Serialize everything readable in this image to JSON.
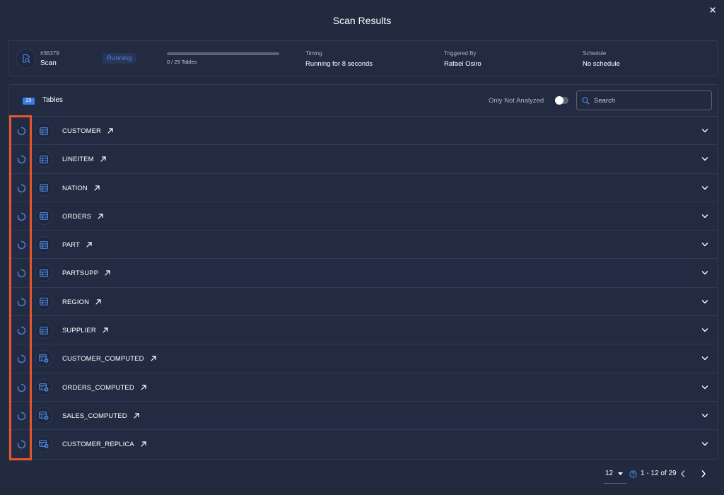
{
  "modal": {
    "title": "Scan Results",
    "close_icon": "close-icon"
  },
  "summary": {
    "scan_id": "#36379",
    "scan_name": "Scan",
    "status": "Running",
    "progress_text": "0 / 29 Tables",
    "progress_fraction": 0,
    "timing_label": "Timing",
    "timing_value": "Running for 8 seconds",
    "triggered_label": "Triggered By",
    "triggered_value": "Rafael Osiro",
    "schedule_label": "Schedule",
    "schedule_value": "No schedule"
  },
  "tables_panel": {
    "count": "29",
    "title": "Tables",
    "filter_label": "Only Not Analyzed",
    "filter_on": false,
    "search_placeholder": "Search",
    "rows": [
      {
        "name": "CUSTOMER",
        "icon": "table-icon"
      },
      {
        "name": "LINEITEM",
        "icon": "table-icon"
      },
      {
        "name": "NATION",
        "icon": "table-icon"
      },
      {
        "name": "ORDERS",
        "icon": "table-icon"
      },
      {
        "name": "PART",
        "icon": "table-icon"
      },
      {
        "name": "PARTSUPP",
        "icon": "table-icon"
      },
      {
        "name": "REGION",
        "icon": "table-icon"
      },
      {
        "name": "SUPPLIER",
        "icon": "table-icon"
      },
      {
        "name": "CUSTOMER_COMPUTED",
        "icon": "computed-table-icon"
      },
      {
        "name": "ORDERS_COMPUTED",
        "icon": "computed-table-icon"
      },
      {
        "name": "SALES_COMPUTED",
        "icon": "computed-table-icon"
      },
      {
        "name": "CUSTOMER_REPLICA",
        "icon": "computed-table-icon"
      }
    ]
  },
  "pagination": {
    "page_size": "12",
    "range": "1 - 12 of 29"
  },
  "colors": {
    "accent": "#3f82ea",
    "highlight": "#e4572e",
    "background": "#222a40"
  }
}
